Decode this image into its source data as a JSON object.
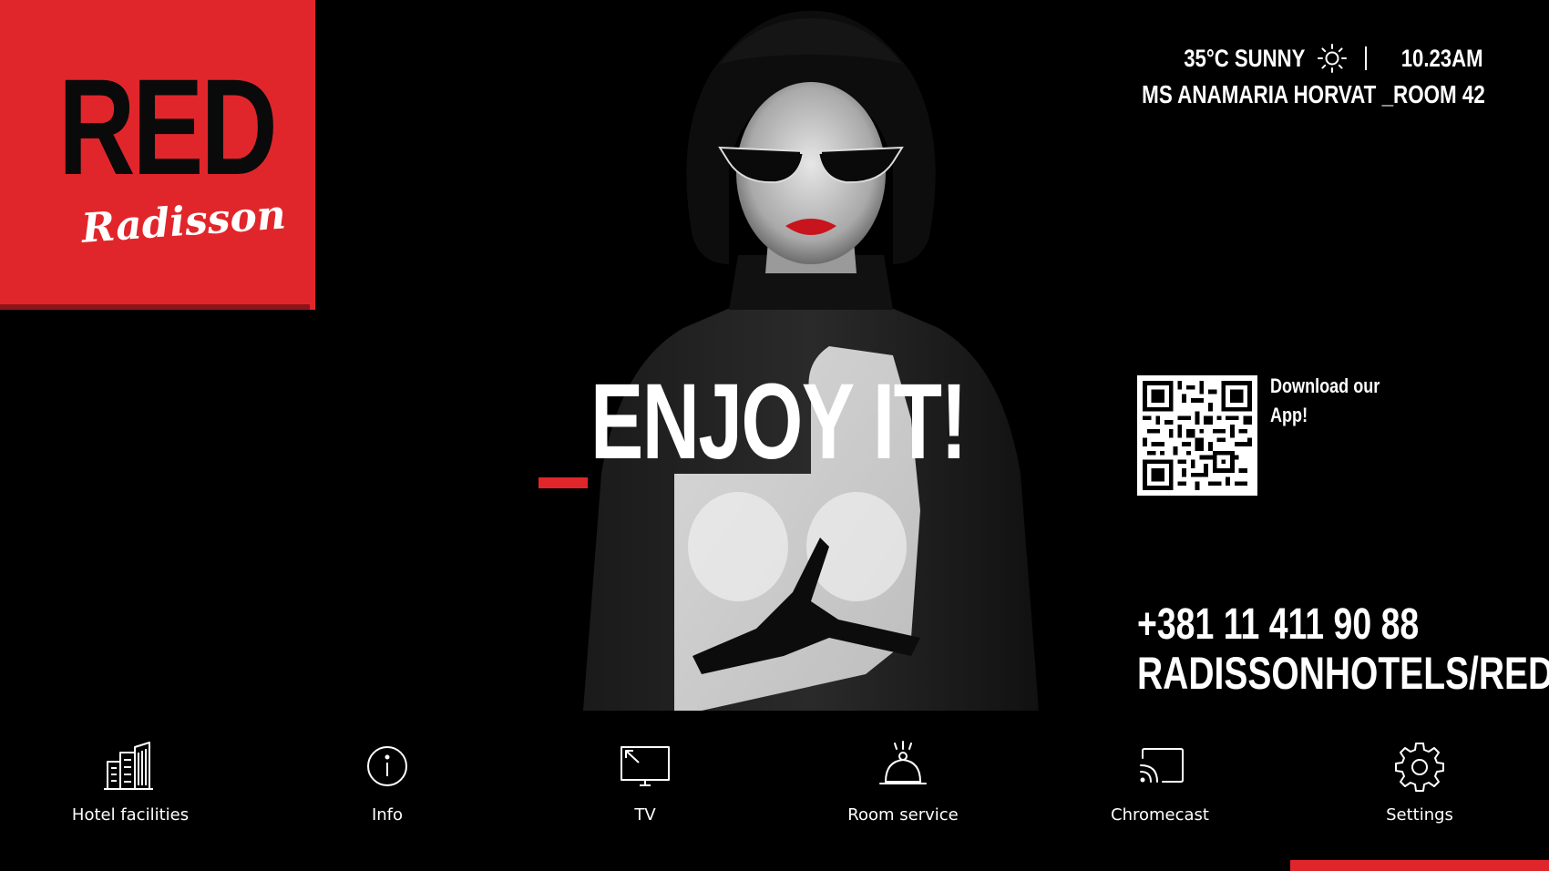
{
  "brand": {
    "title": "RED",
    "script": "Radisson",
    "color": "#e1262b"
  },
  "status": {
    "weather": "35°C SUNNY",
    "weather_icon": "sun-icon",
    "time": "10.23AM",
    "guest": "MS ANAMARIA HORVAT _ROOM 42"
  },
  "hero": {
    "slogan": "ENJOY IT!"
  },
  "app": {
    "download_line1": "Download our",
    "download_line2": "App!",
    "qr_icon": "qr-code-icon"
  },
  "contact": {
    "phone": "+381 11 411 90 88",
    "web": "RADISSONHOTELS/RED"
  },
  "nav": {
    "items": [
      {
        "label": "Hotel facilities",
        "icon": "building-icon"
      },
      {
        "label": "Info",
        "icon": "info-icon"
      },
      {
        "label": "TV",
        "icon": "tv-icon"
      },
      {
        "label": "Room service",
        "icon": "cloche-icon"
      },
      {
        "label": "Chromecast",
        "icon": "cast-icon"
      },
      {
        "label": "Settings",
        "icon": "gear-icon"
      }
    ]
  }
}
